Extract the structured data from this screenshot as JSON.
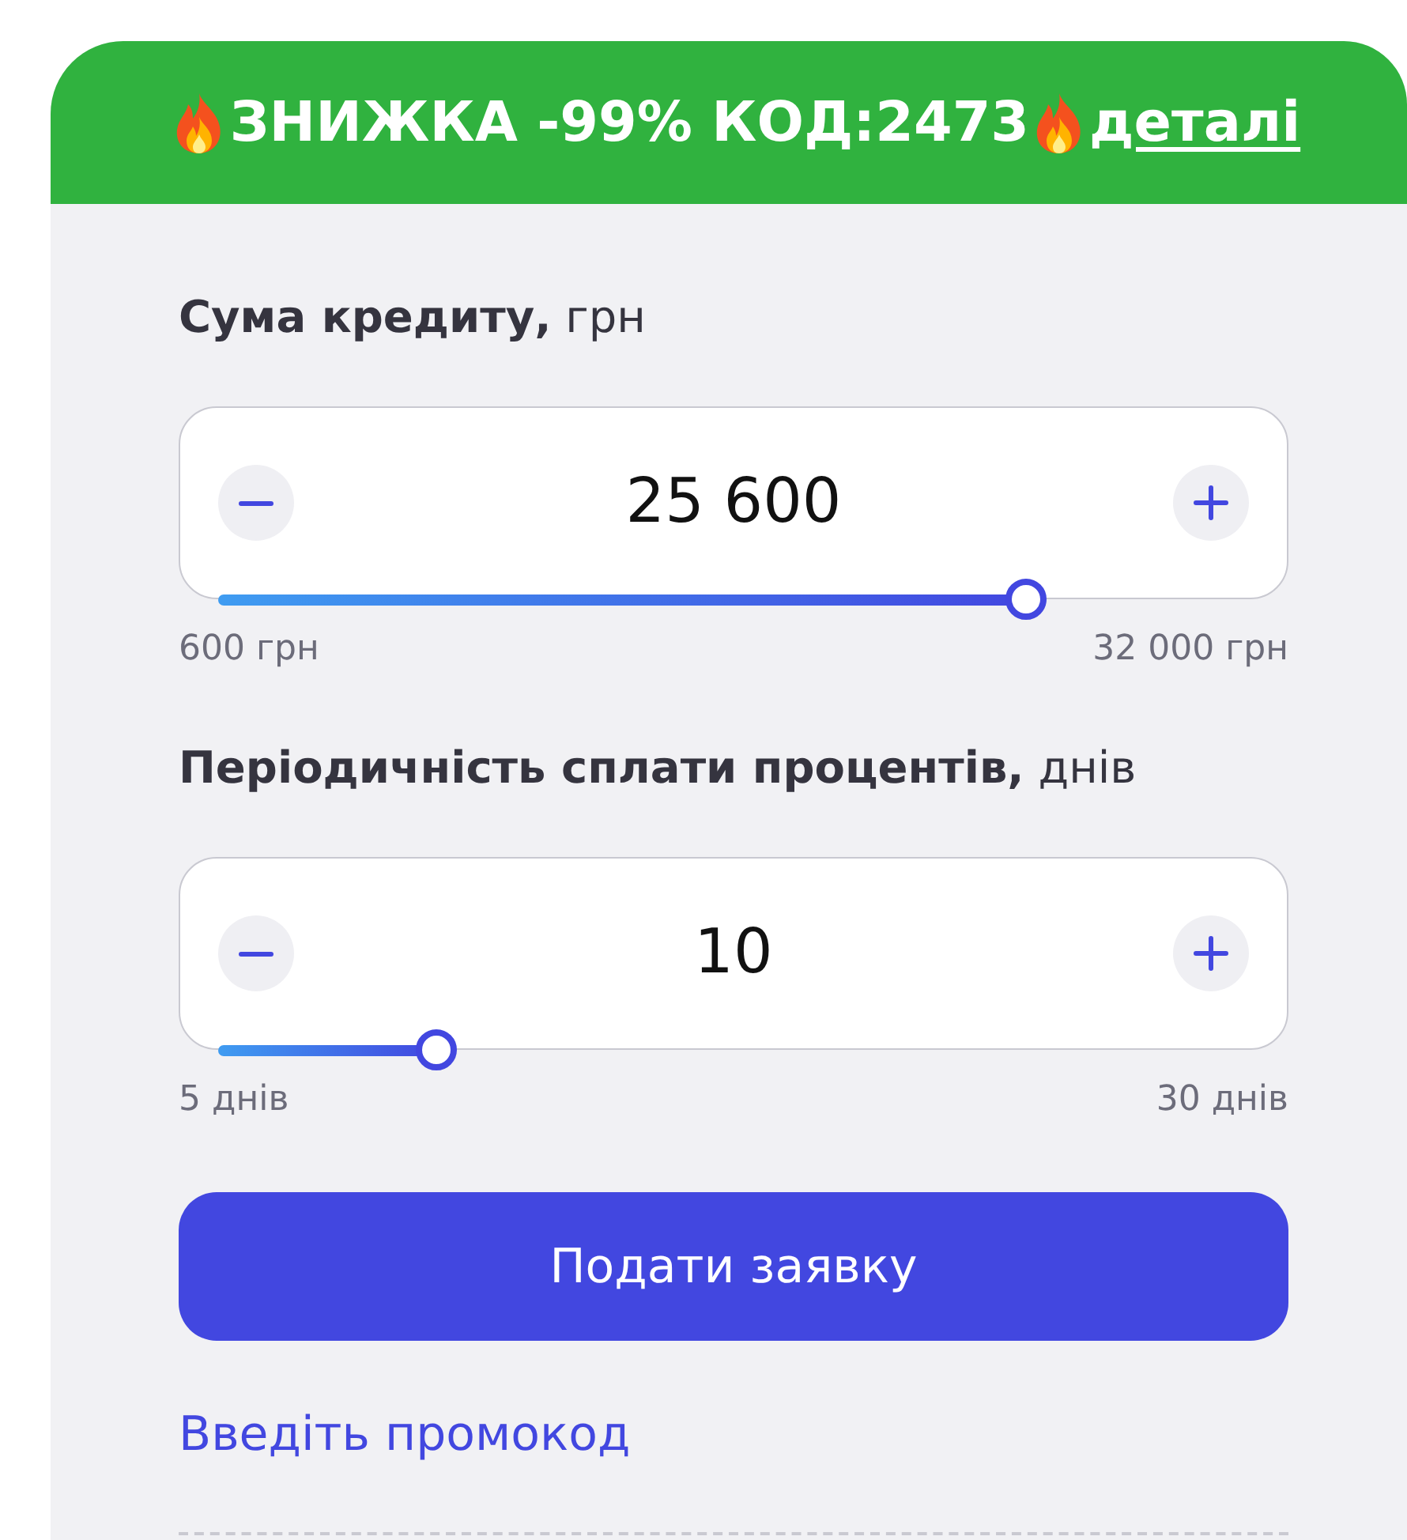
{
  "banner": {
    "text": "ЗНИЖКА -99% КОД:2473",
    "link": "деталі"
  },
  "fields": [
    {
      "label": "**Сума кредиту,** грн",
      "value": "25 600",
      "slider": {
        "level": 0.796
      },
      "min_label": "600 грн",
      "max_label": "32 000 грн"
    },
    {
      "label": "**Періодичність сплати процентів,** днів",
      "value": "10",
      "slider": {
        "level": 0.2
      },
      "min_label": "5 днів",
      "max_label": "30 днів"
    }
  ],
  "submit_button": "Подати заявку",
  "promo_link": "Введіть промокод"
}
